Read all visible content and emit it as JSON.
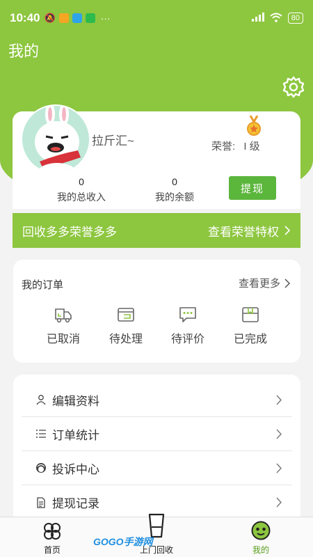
{
  "status_bar": {
    "time": "10:40",
    "battery": "80",
    "dots": "···"
  },
  "page": {
    "title": "我的"
  },
  "profile": {
    "username": "拉斤汇~",
    "honor_label": "荣誉:",
    "honor_level": "I 级",
    "total_income_value": "0",
    "total_income_label": "我的总收入",
    "balance_value": "0",
    "balance_label": "我的余额",
    "withdraw_label": "提现"
  },
  "honor_banner": {
    "slogan": "回收多多荣誉多多",
    "link": "查看荣誉特权"
  },
  "orders": {
    "title": "我的订单",
    "more": "查看更多",
    "items": [
      {
        "label": "已取消",
        "icon": "truck-icon"
      },
      {
        "label": "待处理",
        "icon": "wallet-icon"
      },
      {
        "label": "待评价",
        "icon": "comment-icon"
      },
      {
        "label": "已完成",
        "icon": "box-icon"
      }
    ]
  },
  "menu": {
    "items": [
      {
        "label": "编辑资料",
        "icon": "user-icon"
      },
      {
        "label": "订单统计",
        "icon": "list-icon"
      },
      {
        "label": "投诉中心",
        "icon": "complaint-icon"
      },
      {
        "label": "提现记录",
        "icon": "document-icon"
      }
    ]
  },
  "tabbar": {
    "tabs": [
      {
        "label": "首页",
        "icon": "clover-icon"
      },
      {
        "label": "上门回收",
        "icon": "cup-icon"
      },
      {
        "label": "我的",
        "icon": "face-icon"
      }
    ]
  },
  "watermark": "GOGO手游网",
  "colors": {
    "brand_green": "#8dc63f",
    "button_green": "#5bb63c",
    "background": "#f2f3f2"
  }
}
